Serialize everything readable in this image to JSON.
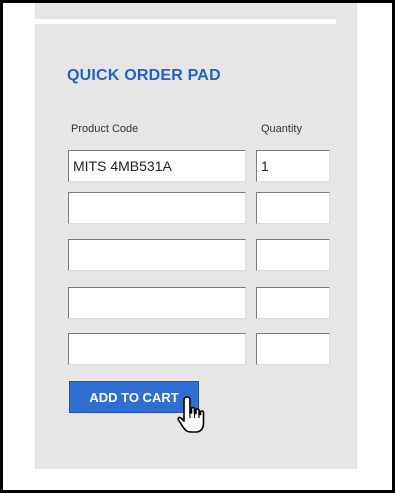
{
  "quick_order": {
    "title": "QUICK ORDER PAD",
    "columns": {
      "product_code": "Product Code",
      "quantity": "Quantity"
    },
    "rows": [
      {
        "code": "MITS 4MB531A",
        "qty": "1"
      },
      {
        "code": "",
        "qty": ""
      },
      {
        "code": "",
        "qty": ""
      },
      {
        "code": "",
        "qty": ""
      },
      {
        "code": "",
        "qty": ""
      }
    ],
    "add_to_cart_label": "ADD TO CART"
  },
  "icons": {
    "cursor": "hand-pointer-icon"
  },
  "colors": {
    "title": "#1f63c6",
    "button": "#2e6fd1",
    "panel": "#e7e6e6"
  }
}
